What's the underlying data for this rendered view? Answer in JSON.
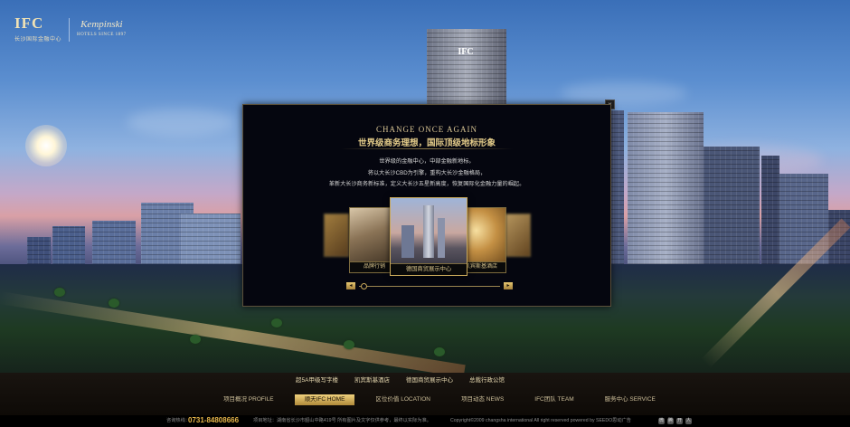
{
  "logo": {
    "brand": "IFC",
    "brand_sub": "长沙国际金融中心",
    "partner": "Kempinski",
    "partner_sub": "HOTELS SINCE 1897"
  },
  "modal": {
    "close_glyph": "×",
    "eyebrow": "CHANGE ONCE AGAIN",
    "title": "世界级商务理想，国际顶级地标形象",
    "body_lines": [
      "世界级的金融中心，中部金融新地标。",
      "将以大长沙CBD为引擎，重构大长沙金融格局，",
      "革新大长沙商务新标准，定义大长沙五星新高度，恢复国际化金融力量的崛起。"
    ],
    "carousel": {
      "items": [
        {
          "label": ""
        },
        {
          "label": "品牌行销"
        },
        {
          "label": "德国商贸展示中心"
        },
        {
          "label": "凯宾斯基酒店"
        },
        {
          "label": ""
        }
      ],
      "prev_glyph": "◂",
      "next_glyph": "▸"
    }
  },
  "subnav": {
    "items": [
      "超5A甲级写字楼",
      "凯宾斯基酒店",
      "德国商贸展示中心",
      "总裁行政公馆"
    ]
  },
  "nav": {
    "items": [
      "项目概况 PROFILE",
      "顺天IFC HOME",
      "区位价值 LOCATION",
      "项目动态 NEWS",
      "IFC团队 TEAM",
      "服务中心 SERVICE"
    ],
    "active_index": 1
  },
  "footer": {
    "hotline_label": "咨询热线：",
    "phone": "0731-84808666",
    "address": "项目地址：湖南省长沙市韶山中路419号  所有图片及文字仅供参考，最终以实际为准。",
    "copyright": "Copyright©2009 changsha international All right reserved    powered by SEEDO思动广告",
    "social_icons": [
      "weibo-icon",
      "tencent-weibo-icon",
      "kaixin-icon",
      "renren-icon"
    ]
  }
}
